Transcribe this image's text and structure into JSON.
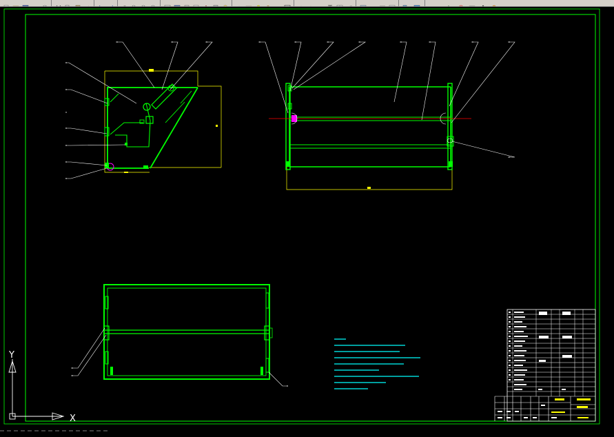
{
  "app": {
    "toolbar_icons": [
      "new-icon",
      "open-icon",
      "save-icon",
      "print-icon",
      "preview-icon",
      "cut-icon",
      "copy-icon",
      "paste-icon",
      "match-icon",
      "undo-icon",
      "redo-icon",
      "pan-icon",
      "zoom-realtime-icon",
      "zoom-window-icon",
      "zoom-previous-icon",
      "properties-icon",
      "design-center-icon",
      "tool-palettes-icon",
      "sheet-set-icon",
      "markup-icon",
      "calc-icon",
      "help-icon"
    ]
  },
  "drawing": {
    "colors": {
      "background": "#000000",
      "frame": "#00ff00",
      "part": "#00ff00",
      "dimension": "#ffff00",
      "leader": "#ffffff",
      "center_line": "#ff0000",
      "highlight": "#ff00ff",
      "note_text": "#00ffff",
      "table_text": "#ffffff"
    },
    "ucs": {
      "x_label": "X",
      "y_label": "Y"
    }
  }
}
